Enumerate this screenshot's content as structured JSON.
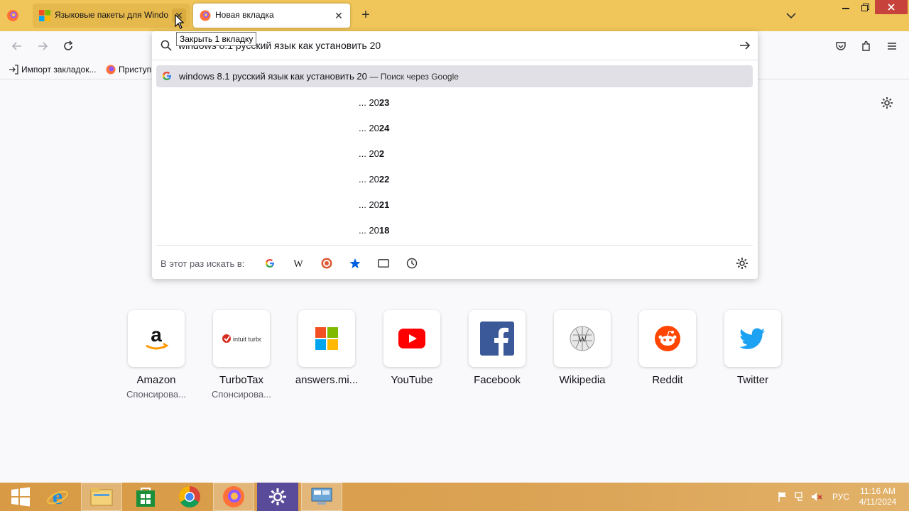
{
  "tabs": [
    {
      "title": "Языковые пакеты для Windo",
      "favicon": "microsoft-icon",
      "active": false
    },
    {
      "title": "Новая вкладка",
      "favicon": "firefox-icon",
      "active": true
    }
  ],
  "tooltip": "Закрыть 1 вкладку",
  "bookmarks": [
    {
      "label": "Импорт закладок...",
      "icon": "import-icon"
    },
    {
      "label": "Приступ",
      "icon": "firefox-icon"
    }
  ],
  "urlbar": {
    "value": "windows 8.1 русский язык как установить 20",
    "main_suggestion": "windows 8.1 русский язык как установить 20",
    "main_action": "— Поиск через Google",
    "suggestions": [
      {
        "prefix": "... 20",
        "bold": "23"
      },
      {
        "prefix": "... 20",
        "bold": "24"
      },
      {
        "prefix": "... 20",
        "bold": "2"
      },
      {
        "prefix": "... 20",
        "bold": "22"
      },
      {
        "prefix": "... 20",
        "bold": "21"
      },
      {
        "prefix": "... 20",
        "bold": "18"
      }
    ],
    "oneoff_label": "В этот раз искать в:"
  },
  "top_sites": [
    {
      "label": "Amazon",
      "sponsored": "Спонсирова..."
    },
    {
      "label": "TurboTax",
      "sponsored": "Спонсирова..."
    },
    {
      "label": "answers.mi...",
      "sponsored": ""
    },
    {
      "label": "YouTube",
      "sponsored": ""
    },
    {
      "label": "Facebook",
      "sponsored": ""
    },
    {
      "label": "Wikipedia",
      "sponsored": ""
    },
    {
      "label": "Reddit",
      "sponsored": ""
    },
    {
      "label": "Twitter",
      "sponsored": ""
    }
  ],
  "turbotax_logo_text": "intuit turbotax",
  "taskbar": {
    "lang": "РУС",
    "time": "11:16 AM",
    "date": "4/11/2024"
  },
  "colors": {
    "tabbar": "#f0c65a",
    "close": "#c7423a",
    "taskbar": "#d89a44"
  }
}
